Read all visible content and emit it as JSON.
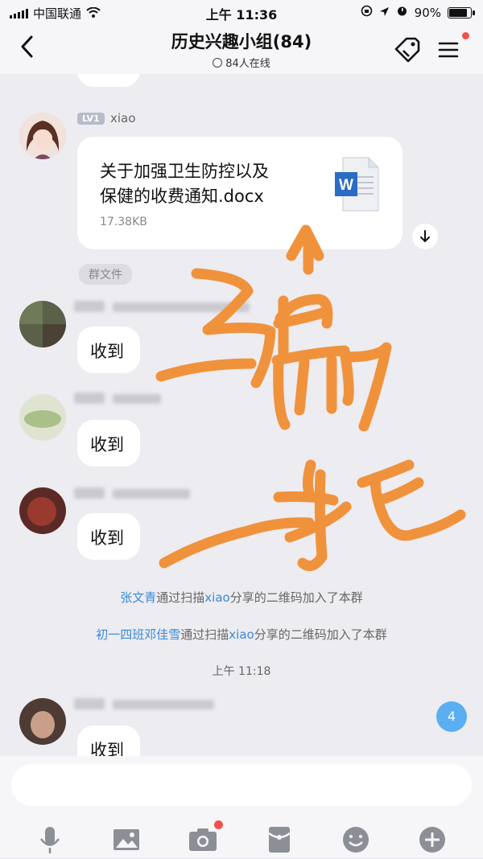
{
  "status_bar": {
    "carrier": "中国联通",
    "time": "上午 11:36",
    "battery": "90%",
    "battery_level": 0.9
  },
  "header": {
    "title": "历史兴趣小组(84)",
    "online": "84人在线"
  },
  "messages": {
    "file_msg": {
      "level": "LV1",
      "sender": "xiao",
      "file_name_line1": "关于加强卫生防控以及",
      "file_name_line2": "保健的收费通知.docx",
      "file_size": "17.38KB",
      "file_tag": "群文件"
    },
    "reply_text": "收到",
    "system_1": {
      "name": "张文青",
      "mid": "通过扫描",
      "sharer": "xiao",
      "rest": "分享的二维码加入了本群"
    },
    "system_2": {
      "name": "初一四班邓佳雪",
      "mid": "通过扫描",
      "sharer": "xiao",
      "rest": "分享的二维码加入了本群"
    },
    "timestamp": "上午 11:18",
    "unread_count": "4"
  },
  "graffiti": {
    "text": "骗一托",
    "color": "#f0923c"
  },
  "toolbar": {
    "icons": [
      "mic-icon",
      "image-icon",
      "camera-icon",
      "red-packet-icon",
      "emoji-icon",
      "plus-icon"
    ]
  }
}
